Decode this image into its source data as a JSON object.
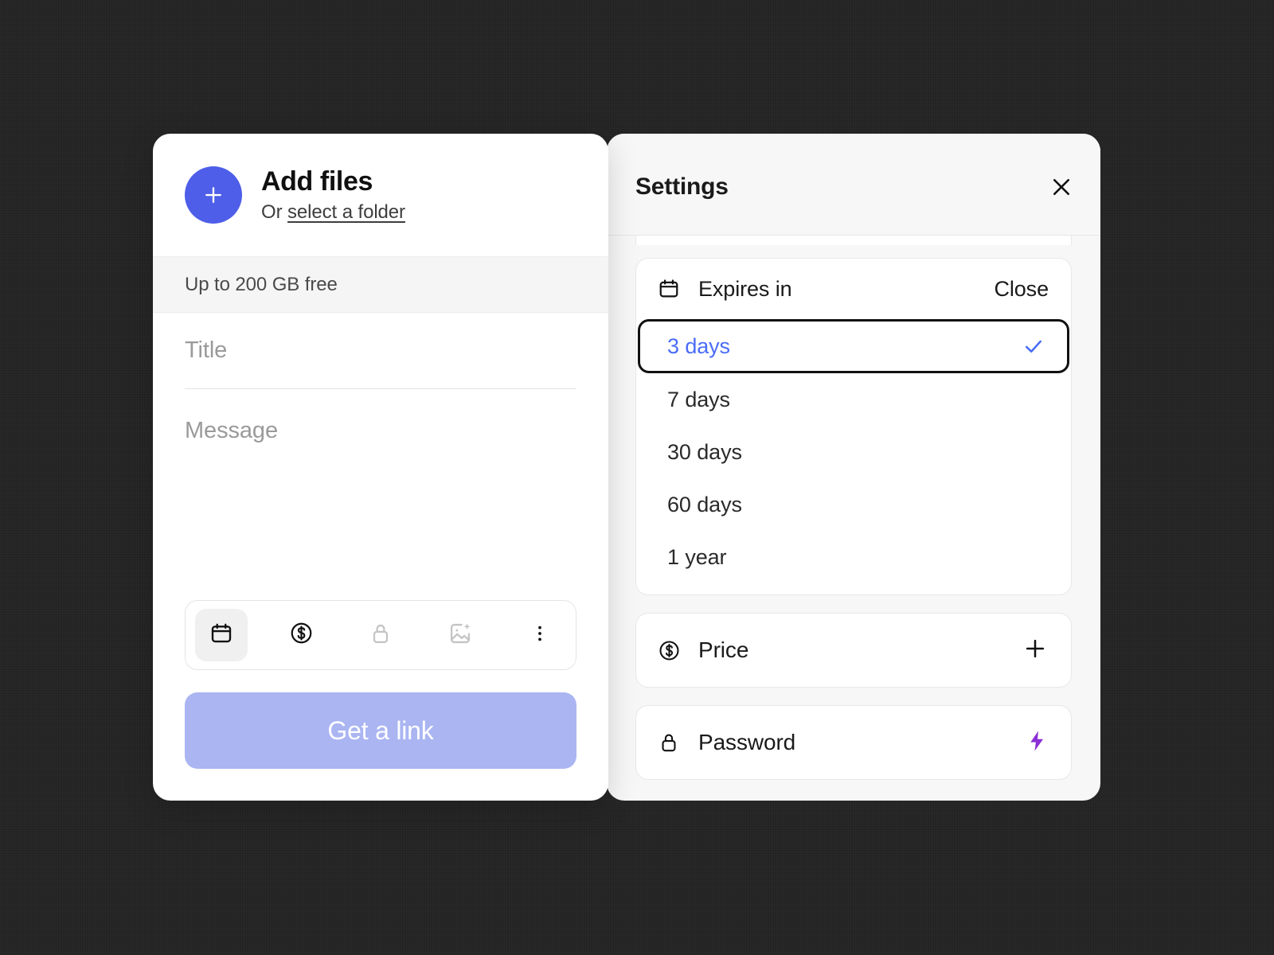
{
  "theme": {
    "backdrop": "#232323",
    "accent_blue": "#4e5ee8",
    "cta_disabled": "#aab5f2",
    "selected_text": "#4a6cf7",
    "focus_ring": "#111111",
    "pro_bolt": "#8b2fd6",
    "panel_bg": "#ffffff",
    "settings_bg": "#f7f7f7"
  },
  "left_panel": {
    "add_files": {
      "icon": "plus-icon",
      "title": "Add files",
      "sub_prefix": "Or ",
      "sub_link": "select a folder"
    },
    "quota": "Up to 200 GB free",
    "fields": {
      "title": {
        "value": "",
        "placeholder": "Title"
      },
      "message": {
        "value": "",
        "placeholder": "Message"
      }
    },
    "toolbar": [
      {
        "name": "calendar-icon",
        "label": "Expires in",
        "active": true,
        "muted": false
      },
      {
        "name": "dollar-circle-icon",
        "label": "Price",
        "active": false,
        "muted": false
      },
      {
        "name": "lock-icon",
        "label": "Password",
        "active": false,
        "muted": true
      },
      {
        "name": "image-sparkle-icon",
        "label": "Custom background",
        "active": false,
        "muted": true
      },
      {
        "name": "more-vertical-icon",
        "label": "More options",
        "active": false,
        "muted": false
      }
    ],
    "cta_label": "Get a link"
  },
  "settings_panel": {
    "title": "Settings",
    "close_icon": "close-icon",
    "expires": {
      "icon": "calendar-icon",
      "label": "Expires in",
      "action_label": "Close",
      "selected": "3 days",
      "options": [
        {
          "label": "3 days",
          "selected": true
        },
        {
          "label": "7 days",
          "selected": false
        },
        {
          "label": "30 days",
          "selected": false
        },
        {
          "label": "60 days",
          "selected": false
        },
        {
          "label": "1 year",
          "selected": false
        }
      ]
    },
    "price": {
      "icon": "dollar-circle-icon",
      "label": "Price",
      "action_icon": "plus-icon"
    },
    "password": {
      "icon": "lock-icon",
      "label": "Password",
      "action_icon": "bolt-icon"
    }
  }
}
